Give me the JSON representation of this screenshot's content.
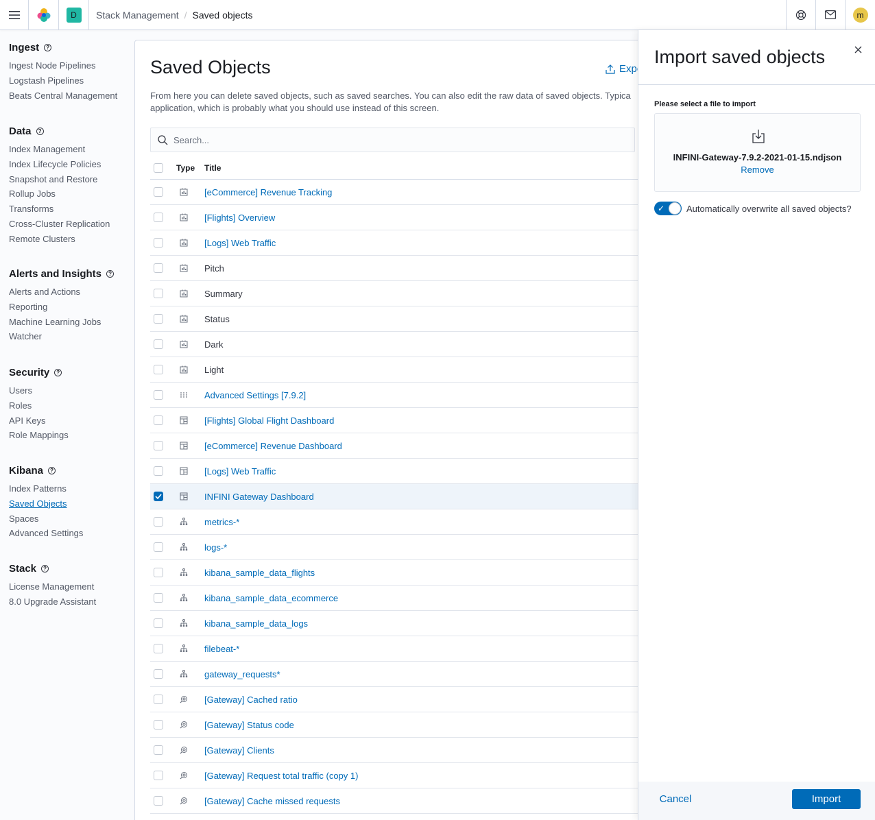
{
  "header": {
    "space_initial": "D",
    "breadcrumbs": [
      "Stack Management",
      "Saved objects"
    ],
    "breadcrumb_separator": "/",
    "avatar_initial": "m",
    "colors": {
      "space": "#20b7a3",
      "avatar": "#e7c64a"
    }
  },
  "sidebar": {
    "groups": [
      {
        "title": "Ingest",
        "items": [
          "Ingest Node Pipelines",
          "Logstash Pipelines",
          "Beats Central Management"
        ]
      },
      {
        "title": "Data",
        "items": [
          "Index Management",
          "Index Lifecycle Policies",
          "Snapshot and Restore",
          "Rollup Jobs",
          "Transforms",
          "Cross-Cluster Replication",
          "Remote Clusters"
        ]
      },
      {
        "title": "Alerts and Insights",
        "items": [
          "Alerts and Actions",
          "Reporting",
          "Machine Learning Jobs",
          "Watcher"
        ]
      },
      {
        "title": "Security",
        "items": [
          "Users",
          "Roles",
          "API Keys",
          "Role Mappings"
        ]
      },
      {
        "title": "Kibana",
        "items": [
          "Index Patterns",
          "Saved Objects",
          "Spaces",
          "Advanced Settings"
        ]
      },
      {
        "title": "Stack",
        "items": [
          "License Management",
          "8.0 Upgrade Assistant"
        ]
      }
    ],
    "active_item": "Saved Objects"
  },
  "main": {
    "title": "Saved Objects",
    "export_label": "Expo",
    "description_line1": "From here you can delete saved objects, such as saved searches. You can also edit the raw data of saved objects. Typica",
    "description_line2": "application, which is probably what you should use instead of this screen.",
    "search_placeholder": "Search...",
    "columns": {
      "type": "Type",
      "title": "Title"
    },
    "rows": [
      {
        "type": "visualization",
        "title": "[eCommerce] Revenue Tracking",
        "link": true,
        "checked": false
      },
      {
        "type": "visualization",
        "title": "[Flights] Overview",
        "link": true,
        "checked": false
      },
      {
        "type": "visualization",
        "title": "[Logs] Web Traffic",
        "link": true,
        "checked": false
      },
      {
        "type": "visualization",
        "title": "Pitch",
        "link": false,
        "checked": false
      },
      {
        "type": "visualization",
        "title": "Summary",
        "link": false,
        "checked": false
      },
      {
        "type": "visualization",
        "title": "Status",
        "link": false,
        "checked": false
      },
      {
        "type": "visualization",
        "title": "Dark",
        "link": false,
        "checked": false
      },
      {
        "type": "visualization",
        "title": "Light",
        "link": false,
        "checked": false
      },
      {
        "type": "config",
        "title": "Advanced Settings [7.9.2]",
        "link": true,
        "checked": false
      },
      {
        "type": "dashboard",
        "title": "[Flights] Global Flight Dashboard",
        "link": true,
        "checked": false
      },
      {
        "type": "dashboard",
        "title": "[eCommerce] Revenue Dashboard",
        "link": true,
        "checked": false
      },
      {
        "type": "dashboard",
        "title": "[Logs] Web Traffic",
        "link": true,
        "checked": false
      },
      {
        "type": "dashboard",
        "title": "INFINI Gateway Dashboard",
        "link": true,
        "checked": true
      },
      {
        "type": "index-pattern",
        "title": "metrics-*",
        "link": true,
        "checked": false
      },
      {
        "type": "index-pattern",
        "title": "logs-*",
        "link": true,
        "checked": false
      },
      {
        "type": "index-pattern",
        "title": "kibana_sample_data_flights",
        "link": true,
        "checked": false
      },
      {
        "type": "index-pattern",
        "title": "kibana_sample_data_ecommerce",
        "link": true,
        "checked": false
      },
      {
        "type": "index-pattern",
        "title": "kibana_sample_data_logs",
        "link": true,
        "checked": false
      },
      {
        "type": "index-pattern",
        "title": "filebeat-*",
        "link": true,
        "checked": false
      },
      {
        "type": "index-pattern",
        "title": "gateway_requests*",
        "link": true,
        "checked": false
      },
      {
        "type": "search",
        "title": "[Gateway] Cached ratio",
        "link": true,
        "checked": false
      },
      {
        "type": "search",
        "title": "[Gateway] Status code",
        "link": true,
        "checked": false
      },
      {
        "type": "search",
        "title": "[Gateway] Clients",
        "link": true,
        "checked": false
      },
      {
        "type": "search",
        "title": "[Gateway] Request total traffic (copy 1)",
        "link": true,
        "checked": false
      },
      {
        "type": "search",
        "title": "[Gateway] Cache missed requests",
        "link": true,
        "checked": false
      }
    ]
  },
  "flyout": {
    "title": "Import saved objects",
    "file_label": "Please select a file to import",
    "file_name": "INFINI-Gateway-7.9.2-2021-01-15.ndjson",
    "remove_label": "Remove",
    "overwrite_label": "Automatically overwrite all saved objects?",
    "overwrite_enabled": true,
    "cancel_label": "Cancel",
    "import_label": "Import"
  },
  "colors": {
    "link": "#006bb8",
    "primary": "#006bb8",
    "text": "#343741"
  }
}
